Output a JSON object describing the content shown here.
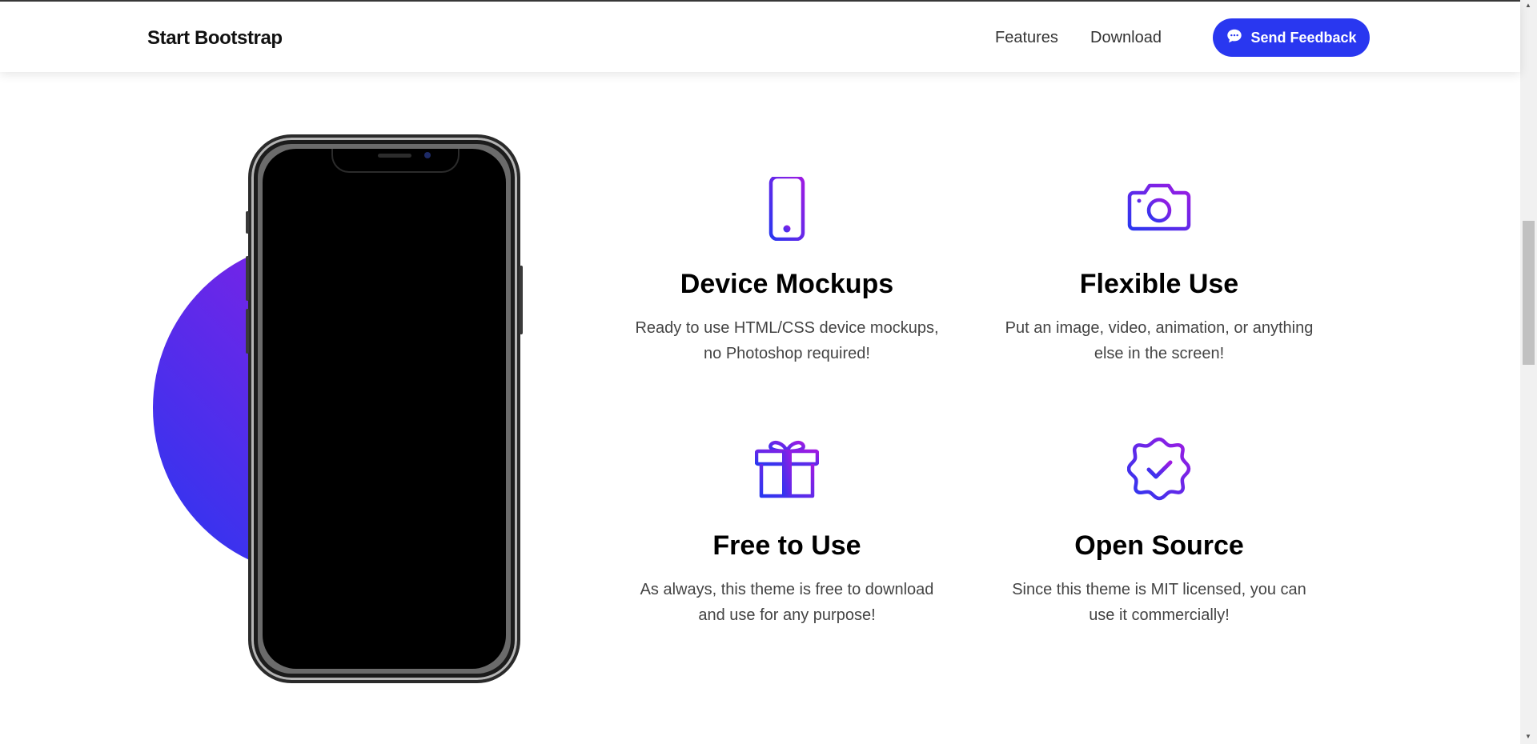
{
  "navbar": {
    "brand": "Start Bootstrap",
    "links": [
      {
        "label": "Features"
      },
      {
        "label": "Download"
      }
    ],
    "cta": {
      "label": "Send Feedback",
      "icon": "chat-icon"
    }
  },
  "colors": {
    "accent": "#2937f0",
    "gradient_start": "#2937f0",
    "gradient_end": "#9f1ae2",
    "text_muted": "#444444"
  },
  "features": [
    {
      "icon": "phone-icon",
      "title": "Device Mockups",
      "text": "Ready to use HTML/CSS device mockups, no Photoshop required!"
    },
    {
      "icon": "camera-icon",
      "title": "Flexible Use",
      "text": "Put an image, video, animation, or anything else in the screen!"
    },
    {
      "icon": "gift-icon",
      "title": "Free to Use",
      "text": "As always, this theme is free to download and use for any purpose!"
    },
    {
      "icon": "patch-check-icon",
      "title": "Open Source",
      "text": "Since this theme is MIT licensed, you can use it commercially!"
    }
  ]
}
